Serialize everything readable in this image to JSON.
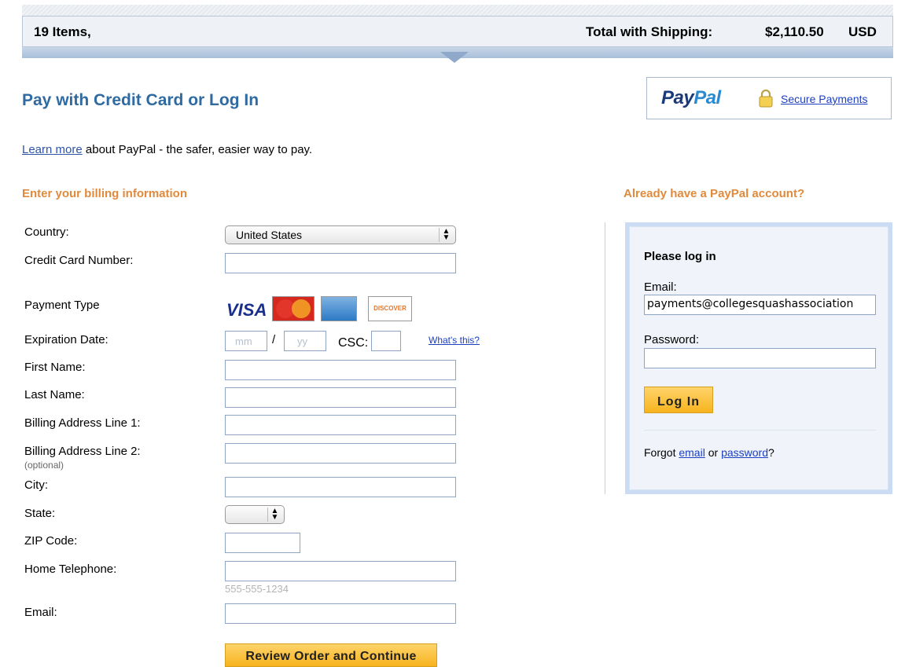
{
  "summary": {
    "items": "19 Items,",
    "total_label": "Total with Shipping:",
    "total_value": "$2,110.50",
    "currency": "USD"
  },
  "header": {
    "title": "Pay with Credit Card or Log In",
    "paypal_logo": "PayPal",
    "secure_link": "Secure Payments"
  },
  "learn": {
    "link": "Learn more",
    "text": " about PayPal - the safer, easier way to pay."
  },
  "billing": {
    "heading": "Enter your billing information",
    "country_label": "Country:",
    "country_value": "United States",
    "card_number_label": "Credit Card Number:",
    "payment_type_label": "Payment Type",
    "cards": [
      "VISA",
      "MasterCard",
      "American Express",
      "DISCOVER"
    ],
    "expiration_label": "Expiration Date:",
    "month_placeholder": "mm",
    "year_placeholder": "yy",
    "date_separator": "/",
    "csc_label": "CSC:",
    "whats_this": "What's this?",
    "first_name_label": "First Name:",
    "last_name_label": "Last Name:",
    "address1_label": "Billing Address Line 1:",
    "address2_label": "Billing Address Line 2:",
    "optional_note": "(optional)",
    "city_label": "City:",
    "state_label": "State:",
    "state_value": "",
    "zip_label": "ZIP Code:",
    "phone_label": "Home Telephone:",
    "phone_hint": "555-555-1234",
    "email_label": "Email:",
    "submit": "Review Order and Continue"
  },
  "login": {
    "heading": "Already have a PayPal account?",
    "title": "Please log in",
    "email_label": "Email:",
    "email_value": "payments@collegesquashassociation",
    "password_label": "Password:",
    "button": "Log In",
    "forgot_prefix": "Forgot ",
    "forgot_email": "email",
    "forgot_or": " or ",
    "forgot_password": "password",
    "forgot_suffix": "?"
  },
  "colors": {
    "title_blue": "#2f6aa1",
    "section_orange": "#e08a3c",
    "button_gold": "#f7b31e",
    "link_blue": "#1c3fbf"
  }
}
